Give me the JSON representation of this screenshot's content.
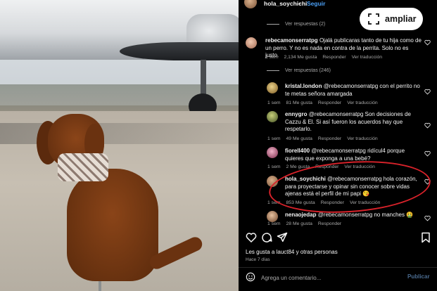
{
  "header": {
    "username": "hola_soychichi",
    "separator": "•",
    "follow_label": "Seguir"
  },
  "overlay": {
    "expand_label": "ampliar",
    "expand_icon": "expand-icon"
  },
  "thread": {
    "view_replies_top": "Ver respuestas (2)",
    "main_comment": {
      "username": "rebecamonserratpg",
      "text": "Ojalá publicaras tanto de tu hija como de un perro. Y no es nada en contra de la perrita. Solo no es justo.",
      "time": "1 sem",
      "likes": "2,134 Me gusta",
      "reply": "Responder",
      "translate": "Ver traducción"
    },
    "view_replies_main": "Ver respuestas (246)",
    "replies": [
      {
        "username": "kristal.london",
        "text": "@rebecamonserratpg con el perrito no te metas señora amargada",
        "time": "1 sem",
        "likes": "81 Me gusta",
        "reply": "Responder",
        "translate": "Ver traducción"
      },
      {
        "username": "ennygro",
        "text": "@rebecamonserratpg Son decisiones de Cazzu & El. Si así fueron los acuerdos hay que respetarlo.",
        "time": "1 sem",
        "likes": "49 Me gusta",
        "reply": "Responder",
        "translate": "Ver traducción"
      },
      {
        "username": "fiorell400",
        "text": "@rebecamonserratpg ridícul4 porque quieres que exponga a una bebé?",
        "time": "1 sem",
        "likes": "2 Me gusta",
        "reply": "Responder",
        "translate": "Ver traducción"
      },
      {
        "username": "hola_soychichi",
        "text": "@rebecamonserratpg hola corazón, para proyectarse y opinar sin conocer sobre vidas ajenas está el perfil de mi papi 😘",
        "time": "1 sem",
        "likes": "853 Me gusta",
        "reply": "Responder",
        "translate": "Ver traducción"
      },
      {
        "username": "nenaojedap",
        "text": "@rebecamonserratpg no manches 🤮",
        "time": "1 sem",
        "likes": "28 Me gusta",
        "reply": "Responder",
        "translate": ""
      }
    ]
  },
  "post": {
    "likes_text": "Les gusta a lauct84 y otras personas",
    "time_ago": "Hace 7 días"
  },
  "composer": {
    "placeholder": "Agrega un comentario...",
    "publish_label": "Publicar"
  },
  "colors": {
    "panel_bg": "#000000",
    "link_blue": "#4a9ff5",
    "highlight_red": "#d8222a",
    "muted_text": "#a8a8a8"
  }
}
